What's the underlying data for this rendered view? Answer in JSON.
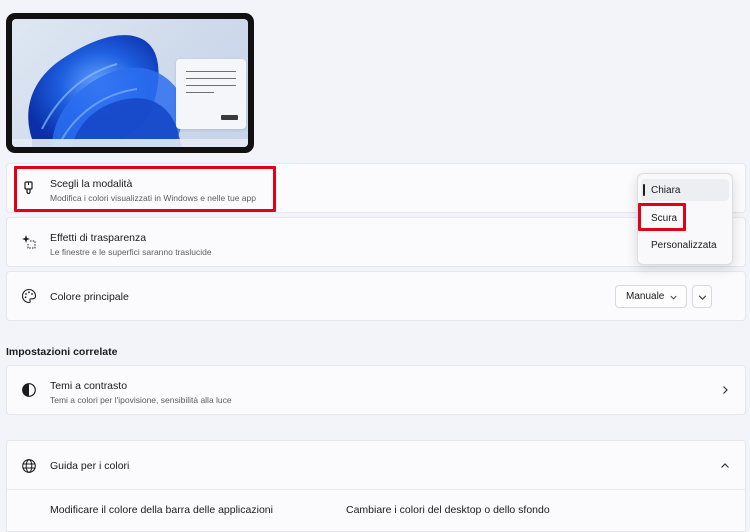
{
  "mode_card": {
    "title": "Scegli la modalità",
    "subtitle": "Modifica i colori visualizzati in Windows e nelle tue app"
  },
  "mode_dropdown": {
    "options": [
      "Chiara",
      "Scura",
      "Personalizzata"
    ],
    "selected": "Chiara"
  },
  "transparency_card": {
    "title": "Effetti di trasparenza",
    "subtitle": "Le finestre e le superfici saranno traslucide"
  },
  "accent_card": {
    "title": "Colore principale",
    "select_value": "Manuale"
  },
  "related_header": "Impostazioni correlate",
  "contrast_card": {
    "title": "Temi a contrasto",
    "subtitle": "Temi a colori per l'ipovisione, sensibilità alla luce"
  },
  "help_card": {
    "title": "Guida per i colori",
    "links": [
      "Modificare il colore della barra delle applicazioni",
      "Cambiare i colori del desktop o dello sfondo"
    ]
  },
  "colors": {
    "highlight": "#e30016",
    "background": "#f3f4f9",
    "card": "#fbfbfd",
    "bloom_blue": "#1e5fe0"
  },
  "icons": {
    "mode": "brush-icon",
    "transparency": "transparency-sparkle-icon",
    "accent": "palette-icon",
    "contrast": "contrast-half-circle-icon",
    "help": "globe-icon"
  }
}
